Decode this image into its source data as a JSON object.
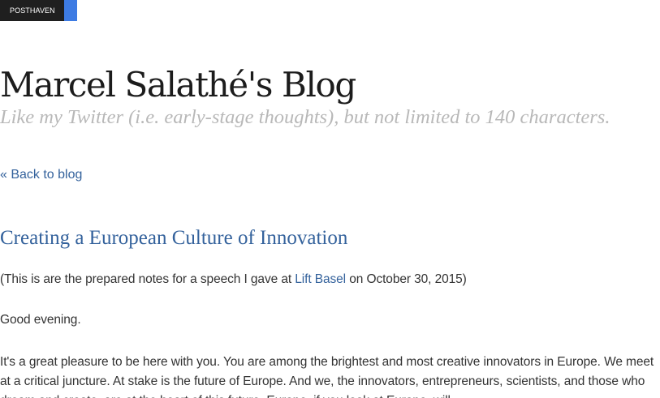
{
  "badge": {
    "label": "POSTHAVEN"
  },
  "blog": {
    "title": "Marcel Salathé's Blog",
    "tagline": "Like my Twitter (i.e. early-stage thoughts), but not limited to 140 characters."
  },
  "nav": {
    "back_label": "« Back to blog"
  },
  "post": {
    "title": "Creating a European Culture of Innovation",
    "intro_prefix": "(This is are the prepared notes for a speech I gave at ",
    "intro_link": "Lift Basel",
    "intro_suffix": " on October 30, 2015)",
    "greeting": "Good evening.",
    "para3": "It's a great pleasure to be here with you. You are among the brightest and most creative innovators in Europe. We meet at a critical juncture. At stake is the future of Europe. And we, the innovators, entrepreneurs, scientists, and those who dream and create, are at the heart of this future. Europe, if you look at Europe, will"
  },
  "colors": {
    "link": "#34629c",
    "badge_dark": "#1f1f1f",
    "badge_accent": "#3d7be3",
    "tagline": "#b8b8b8"
  }
}
